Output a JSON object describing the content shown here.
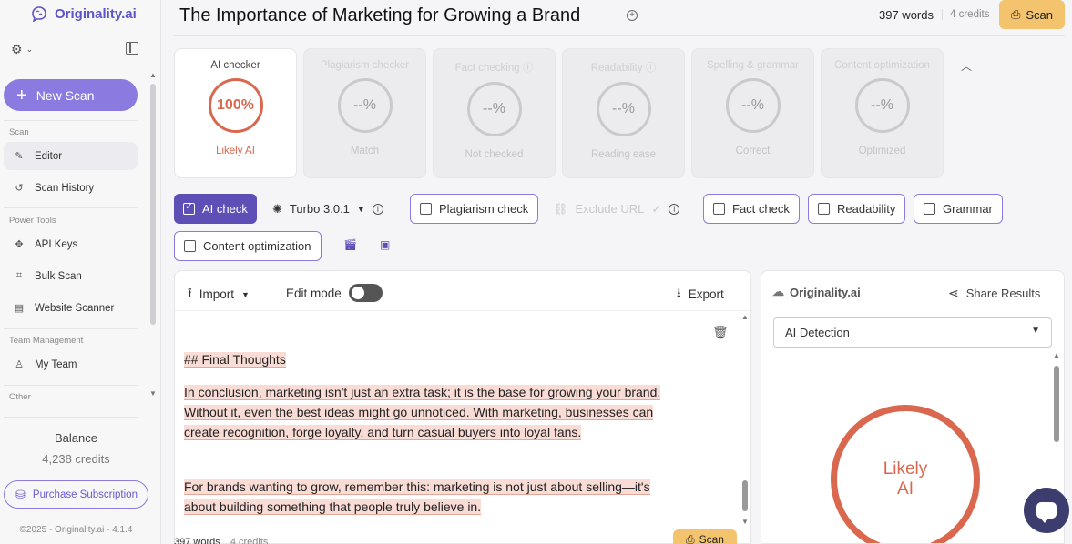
{
  "sidebar": {
    "logo_text": "Originality.ai",
    "new_scan_label": "New Scan",
    "sections": {
      "scan": "Scan",
      "power_tools": "Power Tools",
      "team_management": "Team Management",
      "other": "Other"
    },
    "items": {
      "editor": "Editor",
      "scan_history": "Scan History",
      "api_keys": "API Keys",
      "bulk_scan": "Bulk Scan",
      "website_scanner": "Website Scanner",
      "my_team": "My Team"
    },
    "balance_label": "Balance",
    "balance_value": "4,238 credits",
    "purchase_label": "Purchase Subscription",
    "copyright": "©2025 - Originality.ai - 4.1.4"
  },
  "header": {
    "title": "The Importance of Marketing for Growing a Brand",
    "words": "397 words",
    "credits": "4 credits",
    "scan_label": "Scan"
  },
  "cards": [
    {
      "title": "AI checker",
      "value": "100%",
      "status": "Likely AI"
    },
    {
      "title": "Plagiarism checker",
      "value": "--%",
      "status": "Match"
    },
    {
      "title": "Fact checking",
      "value": "--%",
      "status": "Not checked"
    },
    {
      "title": "Readability",
      "value": "--%",
      "status": "Reading ease"
    },
    {
      "title": "Spelling & grammar",
      "value": "--%",
      "status": "Correct"
    },
    {
      "title": "Content optimization",
      "value": "--%",
      "status": "Optimized"
    }
  ],
  "options": {
    "ai_check": "AI check",
    "model": "Turbo 3.0.1",
    "plagiarism": "Plagiarism check",
    "exclude_url": "Exclude URL",
    "fact_check": "Fact check",
    "readability": "Readability",
    "grammar": "Grammar",
    "content_optimization": "Content optimization"
  },
  "editor": {
    "import_label": "Import",
    "edit_mode_label": "Edit mode",
    "export_label": "Export",
    "heading": "## Final Thoughts",
    "para1_line1": "In conclusion, marketing isn't just an extra task; it is the base for growing your brand.",
    "para1_line2": "Without it, even the best ideas might go unnoticed. With marketing, businesses can",
    "para1_line3": "create recognition, forge loyalty, and turn casual buyers into loyal fans.",
    "para2_line1": "For brands wanting to grow, remember this: marketing is not just about selling—it's",
    "para2_line2": "about building something that people truly believe in.",
    "footer_words": "397 words",
    "footer_credits": "4 credits",
    "footer_scan": "Scan"
  },
  "result": {
    "logo_text": "Originality.ai",
    "share_label": "Share Results",
    "dropdown_value": "AI Detection",
    "verdict_line1": "Likely",
    "verdict_line2": "AI"
  },
  "colors": {
    "accent": "#5e4fb7",
    "accent_light": "#8b7be0",
    "ai_red": "#d9684e",
    "scan_yellow": "#f3c36e"
  }
}
